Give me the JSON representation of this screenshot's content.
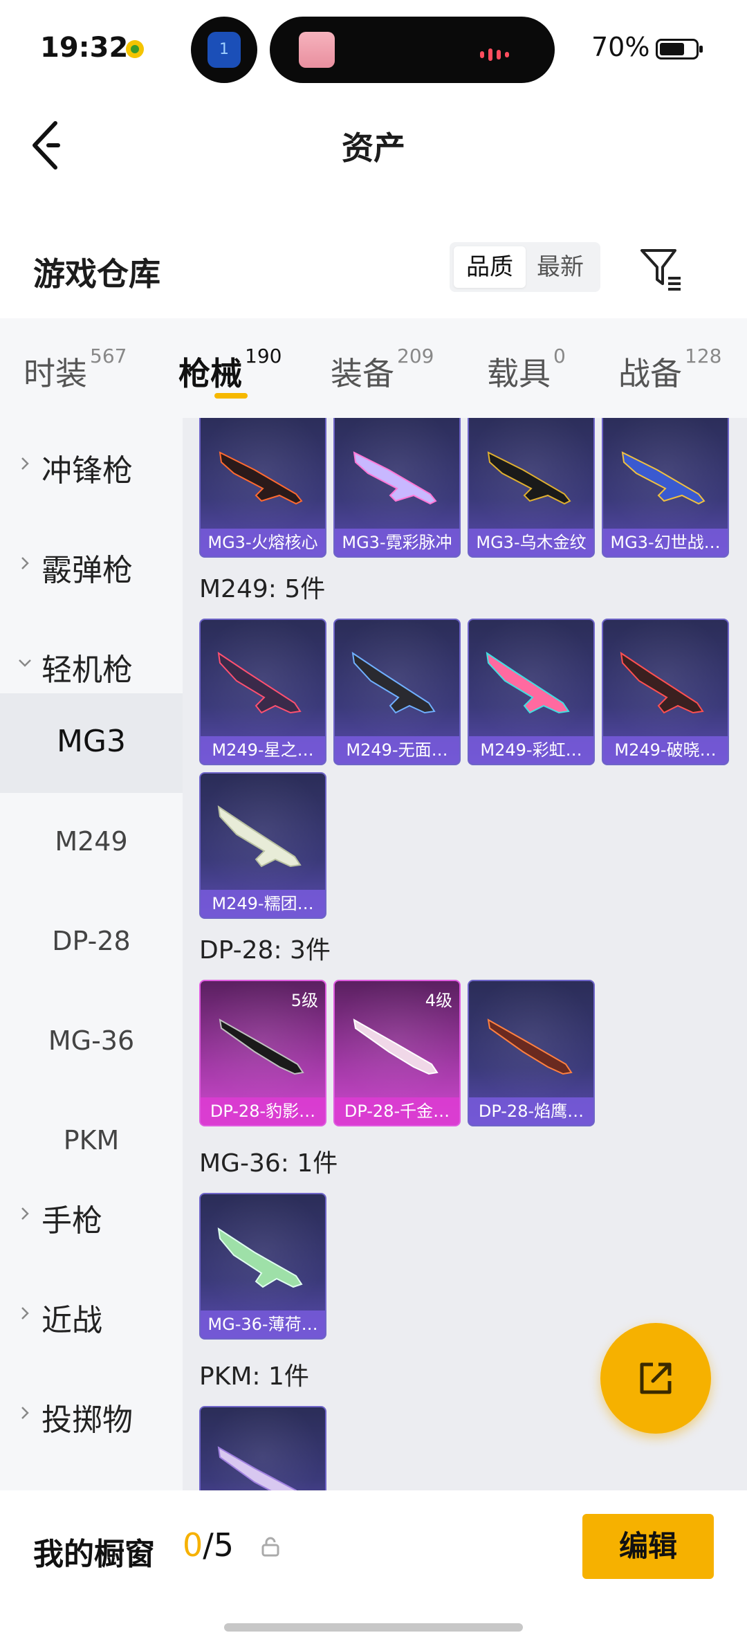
{
  "status_bar": {
    "time": "19:32",
    "battery": "70%",
    "battery_level": 0.7,
    "island_badge": "1"
  },
  "nav": {
    "title": "资产"
  },
  "section": {
    "title": "游戏仓库",
    "sort_options": [
      "品质",
      "最新"
    ],
    "sort_selected": "品质"
  },
  "tabs": [
    {
      "label": "时装",
      "count": "567"
    },
    {
      "label": "枪械",
      "count": "190",
      "active": true
    },
    {
      "label": "装备",
      "count": "209"
    },
    {
      "label": "载具",
      "count": "0"
    },
    {
      "label": "战备",
      "count": "128"
    }
  ],
  "sidebar": {
    "items": [
      {
        "label": "冲锋枪",
        "type": "group",
        "expanded": false
      },
      {
        "label": "霰弹枪",
        "type": "group",
        "expanded": false
      },
      {
        "label": "轻机枪",
        "type": "group",
        "expanded": true
      },
      {
        "label": "MG3",
        "type": "sub",
        "active": true
      },
      {
        "label": "M249",
        "type": "sub"
      },
      {
        "label": "DP-28",
        "type": "sub"
      },
      {
        "label": "MG-36",
        "type": "sub"
      },
      {
        "label": "PKM",
        "type": "sub"
      },
      {
        "label": "手枪",
        "type": "group",
        "expanded": false
      },
      {
        "label": "近战",
        "type": "group",
        "expanded": false
      },
      {
        "label": "投掷物",
        "type": "group",
        "expanded": false
      }
    ]
  },
  "content": {
    "mg3_cards": [
      "MG3-火熔核心",
      "MG3-霓彩脉冲",
      "MG3-乌木金纹",
      "MG3-幻世战…"
    ],
    "groups": [
      {
        "title": "M249: 5件",
        "cards": [
          "M249-星之…",
          "M249-无面…",
          "M249-彩虹…",
          "M249-破晓…",
          "M249-糯团…"
        ]
      },
      {
        "title": "DP-28: 3件",
        "cards": [
          "DP-28-豹影…",
          "DP-28-千金…",
          "DP-28-焰鹰…"
        ],
        "levels": [
          "5级",
          "4级",
          ""
        ]
      },
      {
        "title": "MG-36: 1件",
        "cards": [
          "MG-36-薄荷…"
        ]
      },
      {
        "title": "PKM: 1件",
        "cards": []
      }
    ]
  },
  "bottom": {
    "showcase_label": "我的橱窗",
    "showcase_current": "0",
    "showcase_total": "/5",
    "edit_label": "编辑"
  },
  "colors": {
    "accent": "#f6b100",
    "purple_card": "#3b3a7a",
    "pink_card": "#a43aa8"
  },
  "icons": [
    "back-arrow-icon",
    "filter-icon",
    "chevron-right-icon",
    "chevron-down-icon",
    "share-export-icon",
    "lock-icon"
  ]
}
